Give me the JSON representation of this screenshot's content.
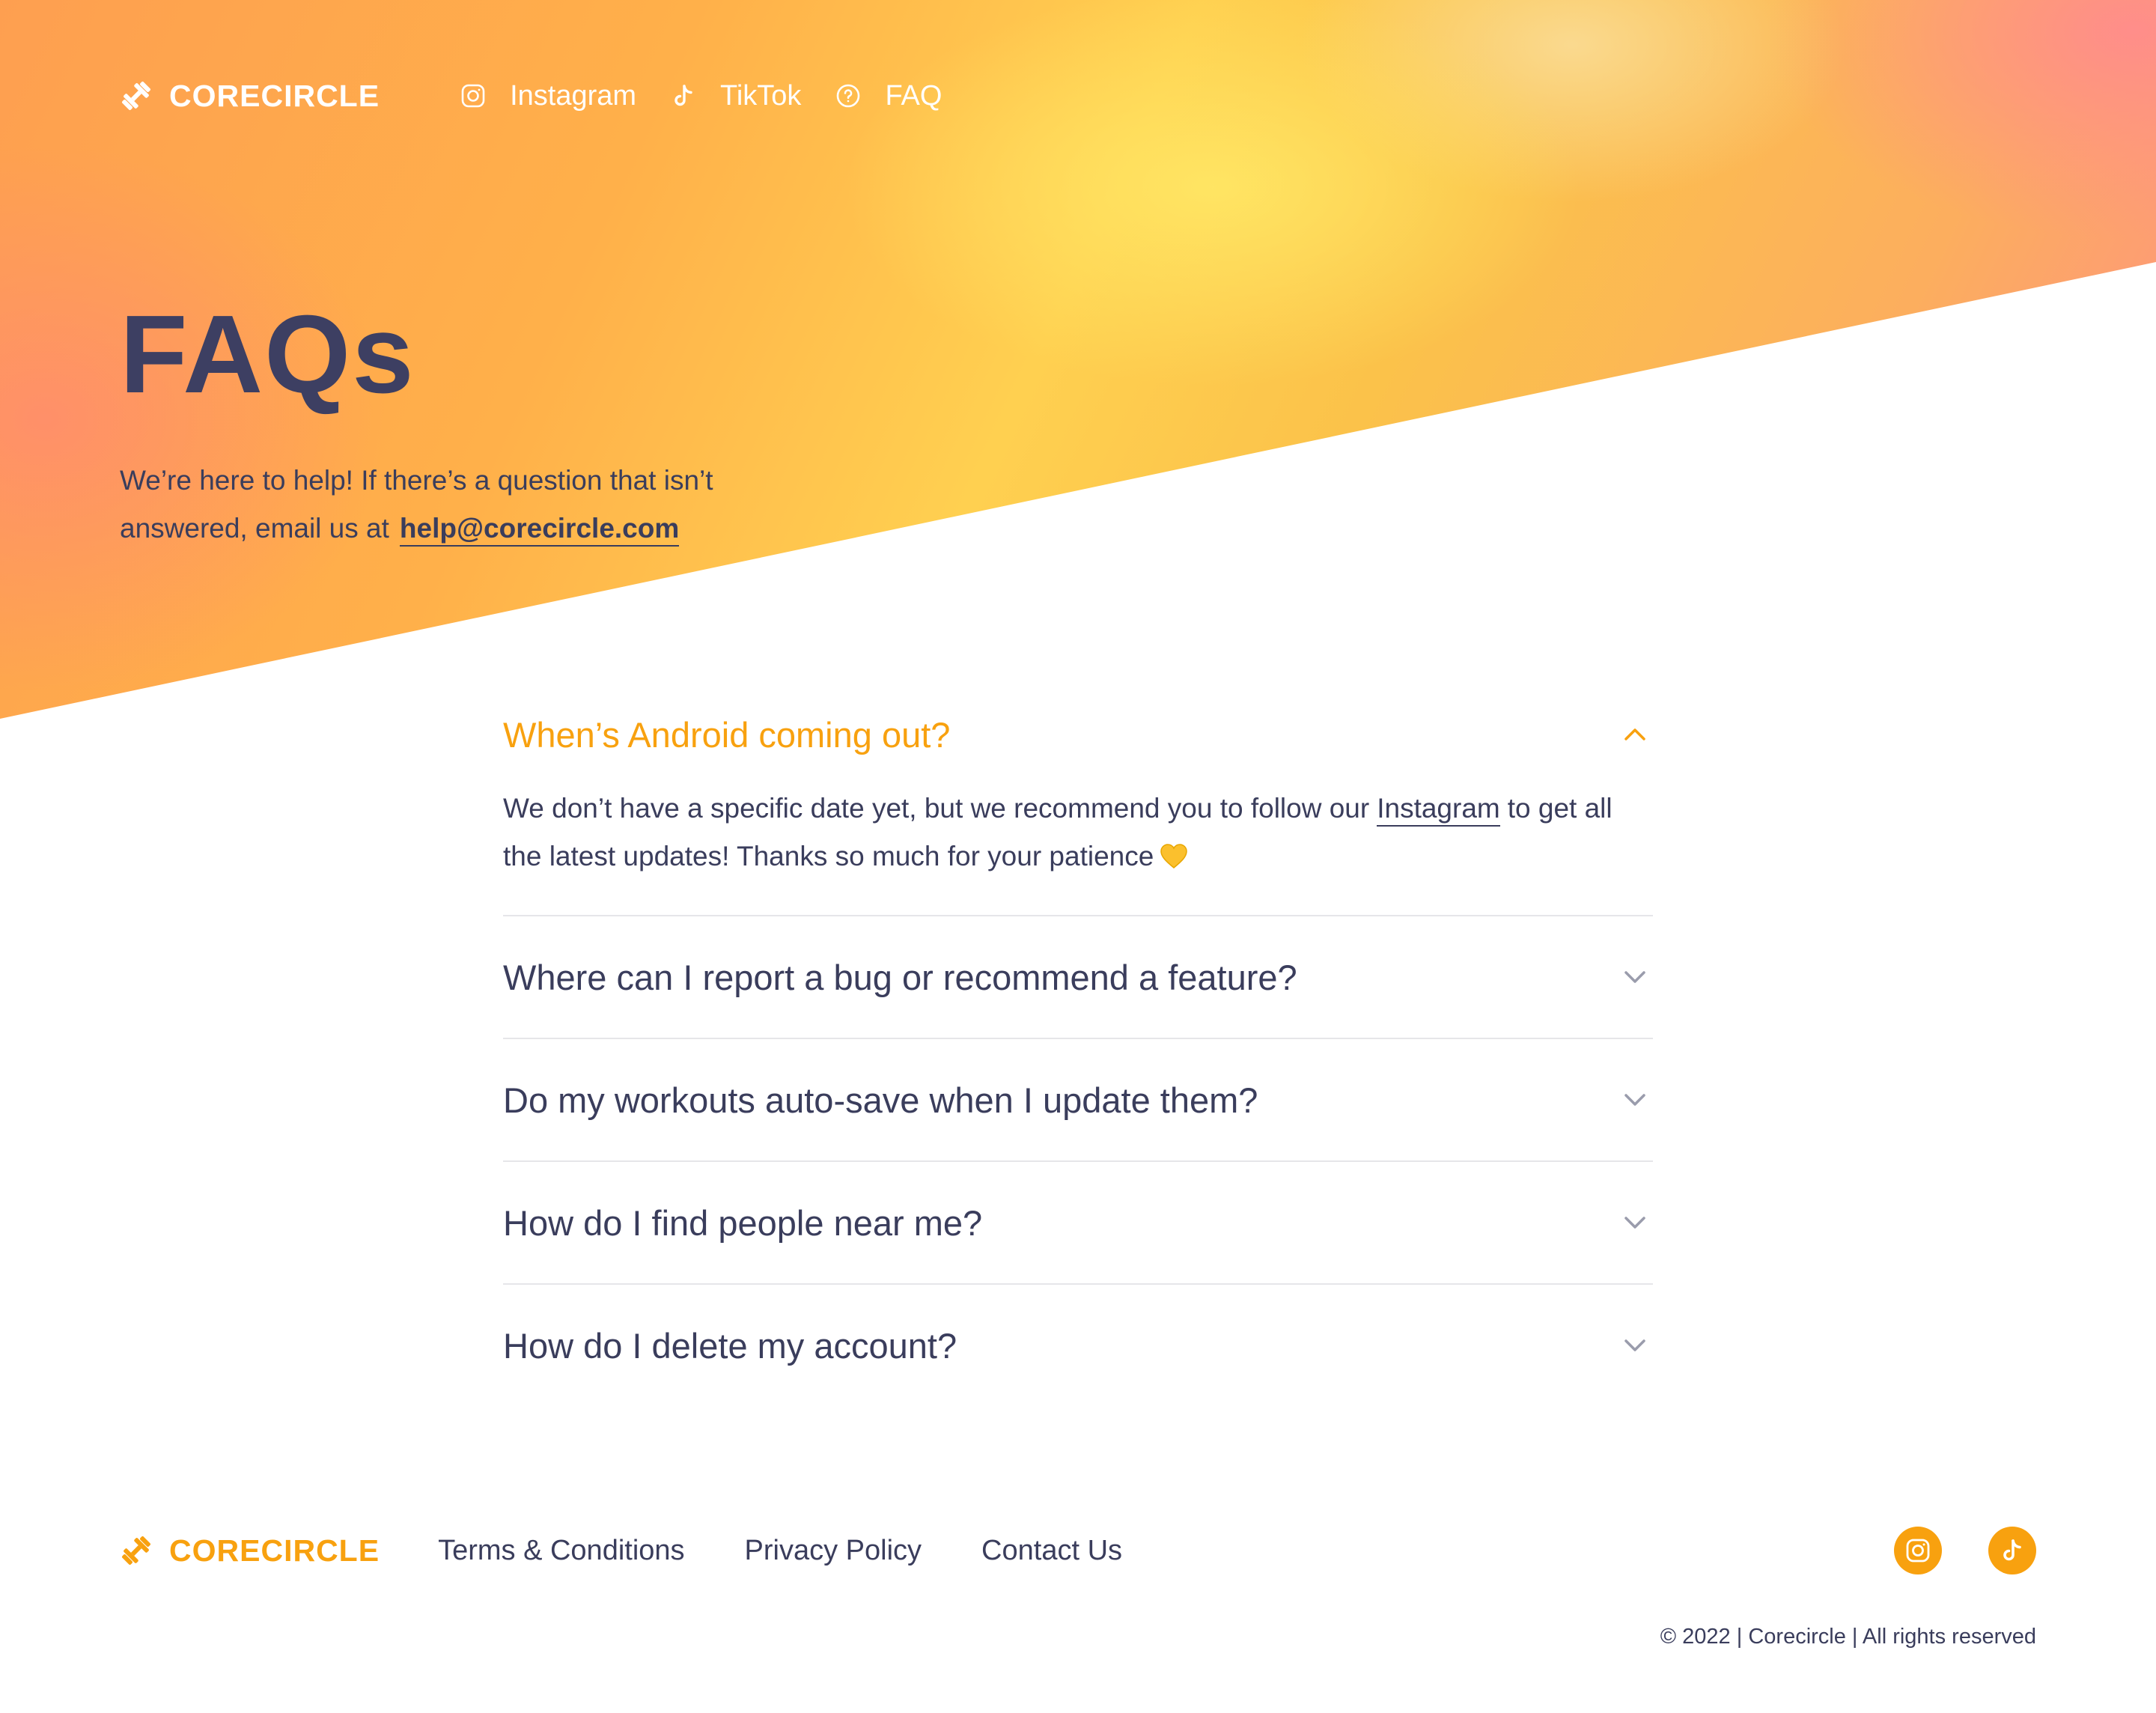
{
  "brand": {
    "name": "CORECIRCLE"
  },
  "nav": {
    "items": [
      {
        "label": "Instagram",
        "icon": "instagram-icon"
      },
      {
        "label": "TikTok",
        "icon": "tiktok-icon"
      },
      {
        "label": "FAQ",
        "icon": "question-circle-icon"
      }
    ]
  },
  "hero": {
    "title": "FAQs",
    "subtitle_line1": "We’re here to help! If there’s a question that isn’t",
    "subtitle_line2": "answered, email us at",
    "email": "help@corecircle.com"
  },
  "faq": {
    "items": [
      {
        "question": "When’s Android coming out?",
        "open": true,
        "answer_part1": "We don’t have a specific date yet, but we recommend you to follow our",
        "answer_link": "Instagram",
        "answer_part2": "to get all the latest updates! Thanks so much for your patience"
      },
      {
        "question": "Where can I report a bug or recommend a feature?",
        "open": false
      },
      {
        "question": "Do my workouts auto-save when I update them?",
        "open": false
      },
      {
        "question": "How do I find people near me?",
        "open": false
      },
      {
        "question": "How do I delete my account?",
        "open": false
      }
    ]
  },
  "footer": {
    "brand": "CORECIRCLE",
    "links": [
      "Terms & Conditions",
      "Privacy Policy",
      "Contact Us"
    ],
    "social": [
      "instagram-icon",
      "tiktok-icon"
    ],
    "copyright": "© 2022 | Corecircle | All rights reserved"
  },
  "colors": {
    "accent": "#f8a10f",
    "text": "#3a3d5c",
    "divider": "#e6e6e9",
    "heart": "#fbc02d"
  }
}
